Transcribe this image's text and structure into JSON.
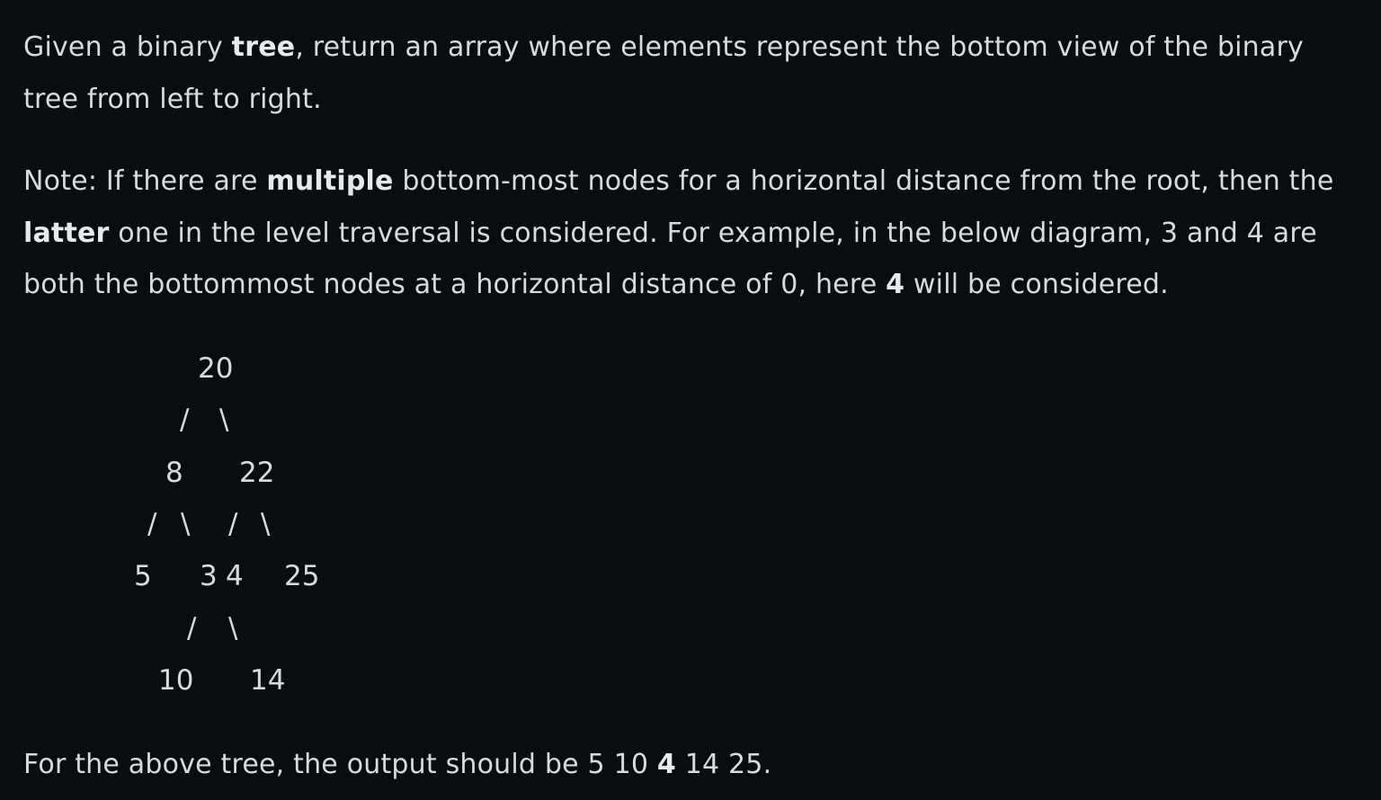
{
  "intro": {
    "before_tree": "Given a binary ",
    "tree_word": "tree",
    "after_tree": ", return an array where elements represent the bottom view of the binary tree from left to right."
  },
  "note": {
    "prefix": "Note: If there are ",
    "multiple_word": "multiple",
    "middle": " bottom-most nodes for a horizontal distance from the root, then the ",
    "latter_word": "latter",
    "after_latter": " one in the level traversal is considered. For example, in the below diagram, 3 and 4 are both the bottommost nodes at a horizontal distance of 0, here ",
    "highlight": "4",
    "suffix": " will be considered."
  },
  "tree": {
    "root": "20",
    "level1_left": "8",
    "level1_right": "22",
    "level2_a": "5",
    "level2_b": "3",
    "level2_c": "4",
    "level2_d": "25",
    "level3_left": "10",
    "level3_right": "14",
    "slash": "/",
    "backslash": "\\"
  },
  "summary": {
    "prefix": "For the above tree, the output should be 5 10 ",
    "highlight": "4",
    "suffix": " 14 25."
  }
}
